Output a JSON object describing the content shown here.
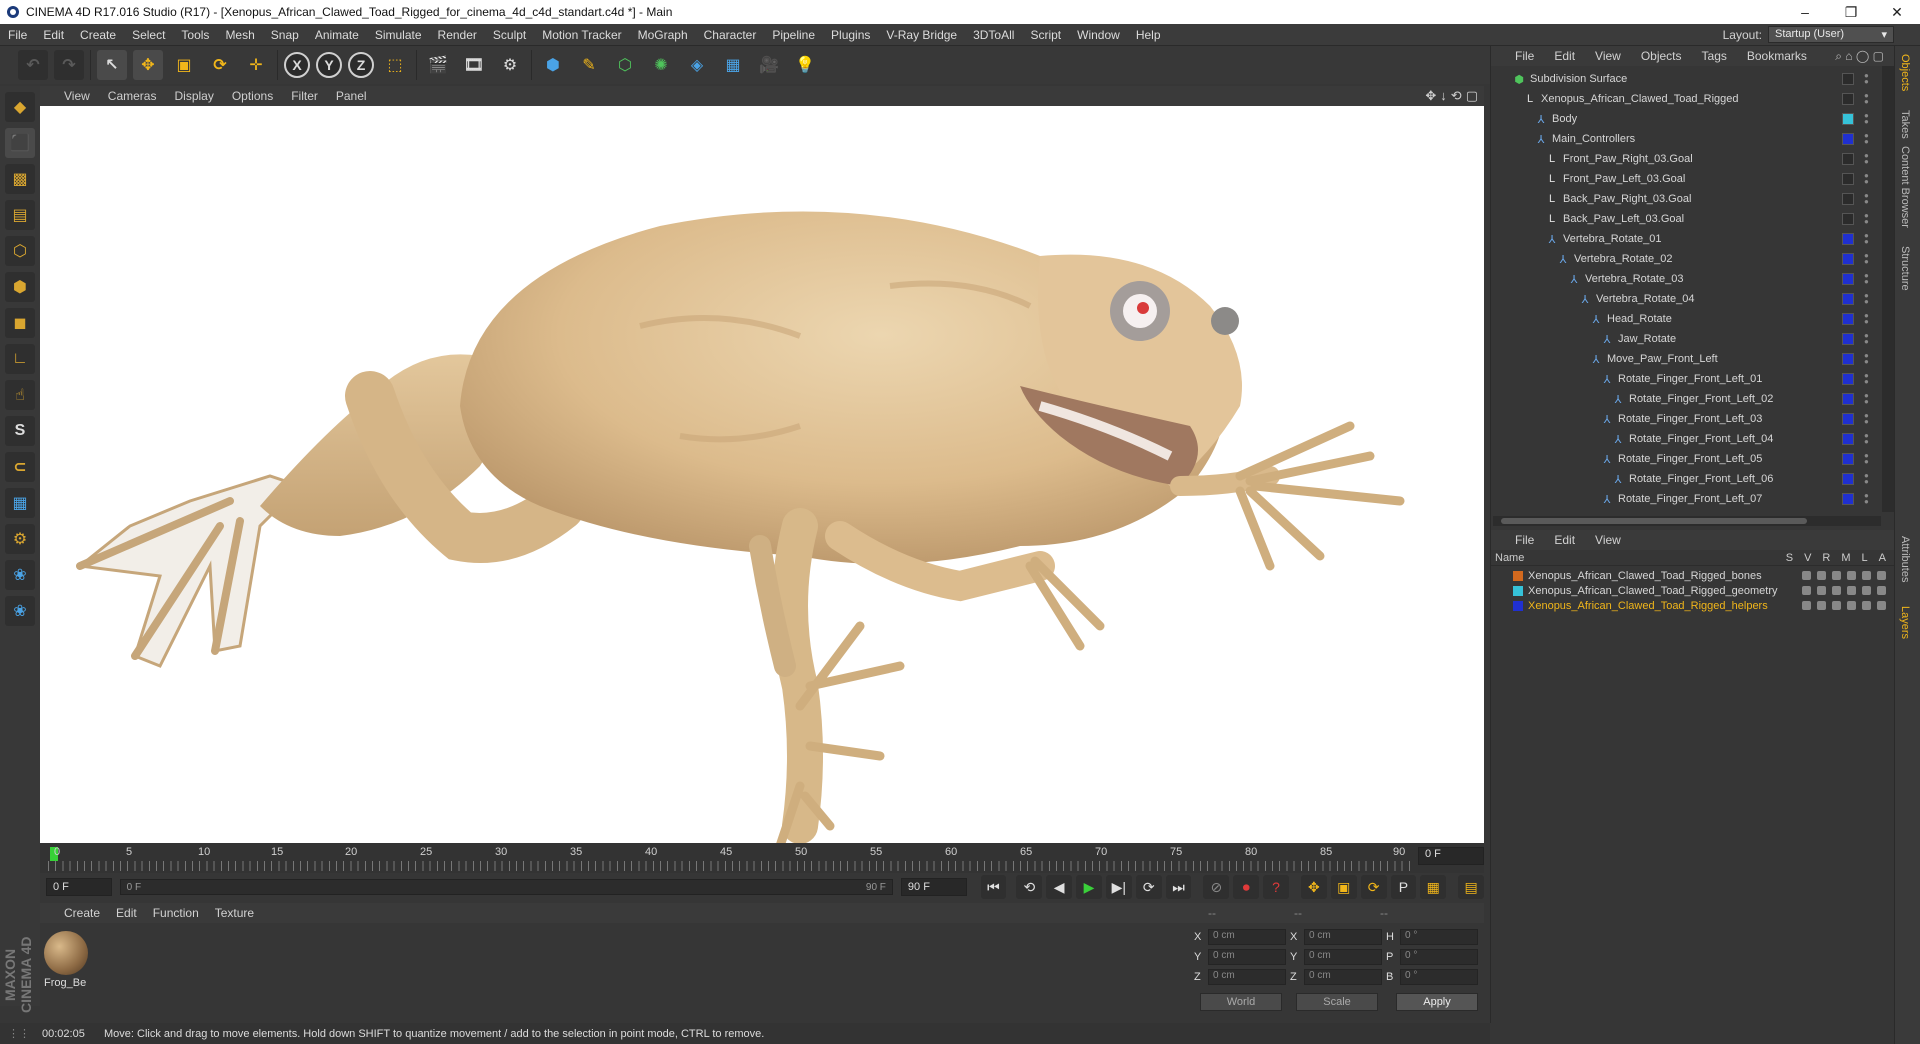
{
  "window": {
    "title": "CINEMA 4D R17.016 Studio (R17) - [Xenopus_African_Clawed_Toad_Rigged_for_cinema_4d_c4d_standart.c4d *] - Main",
    "controls": [
      "–",
      "❐",
      "✕"
    ]
  },
  "menu": [
    "File",
    "Edit",
    "Create",
    "Select",
    "Tools",
    "Mesh",
    "Snap",
    "Animate",
    "Simulate",
    "Render",
    "Sculpt",
    "Motion Tracker",
    "MoGraph",
    "Character",
    "Pipeline",
    "Plugins",
    "V-Ray Bridge",
    "3DToAll",
    "Script",
    "Window",
    "Help"
  ],
  "layout": {
    "label": "Layout:",
    "value": "Startup (User)"
  },
  "viewport": {
    "menu": [
      "View",
      "Cameras",
      "Display",
      "Options",
      "Filter",
      "Panel"
    ],
    "nav_icons": [
      "✥",
      "↓",
      "⟲",
      "▢"
    ]
  },
  "timeline": {
    "ticks": [
      "0",
      "5",
      "10",
      "15",
      "20",
      "25",
      "30",
      "35",
      "40",
      "45",
      "50",
      "55",
      "60",
      "65",
      "70",
      "75",
      "80",
      "85",
      "90"
    ],
    "current_frame": "0 F"
  },
  "transport": {
    "start": "0 F",
    "range_start": "0 F",
    "range_end": "90 F",
    "end": "90 F"
  },
  "materials": {
    "menu": [
      "Create",
      "Edit",
      "Function",
      "Texture"
    ],
    "items": [
      {
        "name": "Frog_Be"
      }
    ]
  },
  "coordinates": {
    "headers": [
      "--",
      "--",
      "--"
    ],
    "rows": [
      {
        "l1": "X",
        "v1": "0 cm",
        "l2": "X",
        "v2": "0 cm",
        "l3": "H",
        "v3": "0 °"
      },
      {
        "l1": "Y",
        "v1": "0 cm",
        "l2": "Y",
        "v2": "0 cm",
        "l3": "P",
        "v3": "0 °"
      },
      {
        "l1": "Z",
        "v1": "0 cm",
        "l2": "Z",
        "v2": "0 cm",
        "l3": "B",
        "v3": "0 °"
      }
    ],
    "mode": "World",
    "scale": "Scale",
    "apply": "Apply"
  },
  "status": {
    "time": "00:02:05",
    "message": "Move: Click and drag to move elements. Hold down SHIFT to quantize movement / add to the selection in point mode, CTRL to remove."
  },
  "object_manager": {
    "menu": [
      "File",
      "Edit",
      "View",
      "Objects",
      "Tags",
      "Bookmarks"
    ],
    "objects": [
      {
        "name": "Subdivision Surface",
        "depth": 0,
        "icon": "subdiv",
        "swatch": "#2b2b2b"
      },
      {
        "name": "Xenopus_African_Clawed_Toad_Rigged",
        "depth": 1,
        "icon": "null",
        "swatch": "#2b2b2b"
      },
      {
        "name": "Body",
        "depth": 2,
        "icon": "joint",
        "swatch": "#36c2d8"
      },
      {
        "name": "Main_Controllers",
        "depth": 2,
        "icon": "joint",
        "swatch": "#2030d0"
      },
      {
        "name": "Front_Paw_Right_03.Goal",
        "depth": 3,
        "icon": "null",
        "swatch": "#2b2b2b"
      },
      {
        "name": "Front_Paw_Left_03.Goal",
        "depth": 3,
        "icon": "null",
        "swatch": "#2b2b2b"
      },
      {
        "name": "Back_Paw_Right_03.Goal",
        "depth": 3,
        "icon": "null",
        "swatch": "#2b2b2b"
      },
      {
        "name": "Back_Paw_Left_03.Goal",
        "depth": 3,
        "icon": "null",
        "swatch": "#2b2b2b"
      },
      {
        "name": "Vertebra_Rotate_01",
        "depth": 3,
        "icon": "joint",
        "swatch": "#2030d0"
      },
      {
        "name": "Vertebra_Rotate_02",
        "depth": 4,
        "icon": "joint",
        "swatch": "#2030d0"
      },
      {
        "name": "Vertebra_Rotate_03",
        "depth": 5,
        "icon": "joint",
        "swatch": "#2030d0"
      },
      {
        "name": "Vertebra_Rotate_04",
        "depth": 6,
        "icon": "joint",
        "swatch": "#2030d0"
      },
      {
        "name": "Head_Rotate",
        "depth": 7,
        "icon": "joint",
        "swatch": "#2030d0"
      },
      {
        "name": "Jaw_Rotate",
        "depth": 8,
        "icon": "joint",
        "swatch": "#2030d0"
      },
      {
        "name": "Move_Paw_Front_Left",
        "depth": 7,
        "icon": "joint",
        "swatch": "#2030d0"
      },
      {
        "name": "Rotate_Finger_Front_Left_01",
        "depth": 8,
        "icon": "joint",
        "swatch": "#2030d0"
      },
      {
        "name": "Rotate_Finger_Front_Left_02",
        "depth": 9,
        "icon": "joint",
        "swatch": "#2030d0"
      },
      {
        "name": "Rotate_Finger_Front_Left_03",
        "depth": 8,
        "icon": "joint",
        "swatch": "#2030d0"
      },
      {
        "name": "Rotate_Finger_Front_Left_04",
        "depth": 9,
        "icon": "joint",
        "swatch": "#2030d0"
      },
      {
        "name": "Rotate_Finger_Front_Left_05",
        "depth": 8,
        "icon": "joint",
        "swatch": "#2030d0"
      },
      {
        "name": "Rotate_Finger_Front_Left_06",
        "depth": 9,
        "icon": "joint",
        "swatch": "#2030d0"
      },
      {
        "name": "Rotate_Finger_Front_Left_07",
        "depth": 8,
        "icon": "joint",
        "swatch": "#2030d0"
      }
    ]
  },
  "layer_manager": {
    "menu": [
      "File",
      "Edit",
      "View"
    ],
    "columns": {
      "name": "Name",
      "flags": [
        "S",
        "V",
        "R",
        "M",
        "L",
        "A"
      ]
    },
    "layers": [
      {
        "name": "Xenopus_African_Clawed_Toad_Rigged_bones",
        "color": "#d2691e",
        "text_color": "#d6d6d6"
      },
      {
        "name": "Xenopus_African_Clawed_Toad_Rigged_geometry",
        "color": "#36c2d8",
        "text_color": "#d6d6d6"
      },
      {
        "name": "Xenopus_African_Clawed_Toad_Rigged_helpers",
        "color": "#2030d0",
        "text_color": "#f1b61a"
      }
    ]
  },
  "right_tabs": [
    "Objects",
    "Takes",
    "Content Browser",
    "Structure",
    "Attributes",
    "Layers"
  ]
}
